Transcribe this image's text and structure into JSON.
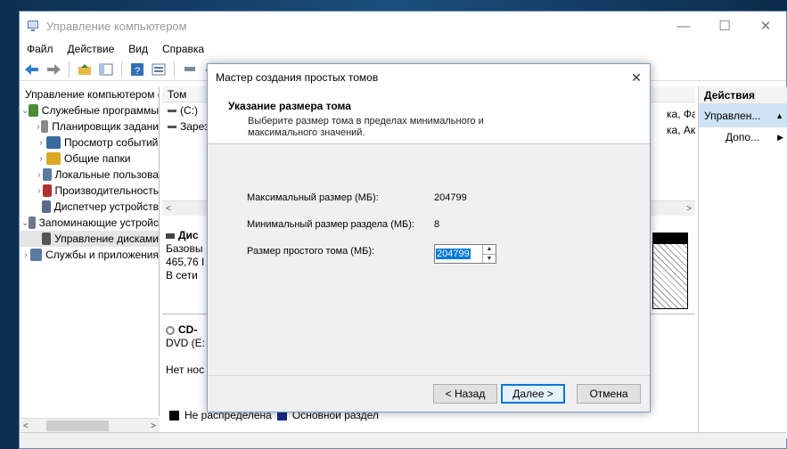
{
  "window": {
    "title": "Управление компьютером",
    "minimize": "—",
    "maximize": "☐",
    "close": "✕"
  },
  "menu": [
    "Файл",
    "Действие",
    "Вид",
    "Справка"
  ],
  "tree": [
    {
      "label": "Управление компьютером (",
      "chev": "",
      "indent": 0,
      "color": "#6a7a8a"
    },
    {
      "label": "Служебные программы",
      "chev": "⌄",
      "indent": 0,
      "color": "#4a8a3a"
    },
    {
      "label": "Планировщик задани",
      "chev": "›",
      "indent": 1,
      "color": "#888"
    },
    {
      "label": "Просмотр событий",
      "chev": "›",
      "indent": 1,
      "color": "#3a6aa0"
    },
    {
      "label": "Общие папки",
      "chev": "›",
      "indent": 1,
      "color": "#d9a825"
    },
    {
      "label": "Локальные пользова",
      "chev": "›",
      "indent": 1,
      "color": "#5a7aa0"
    },
    {
      "label": "Производительность",
      "chev": "›",
      "indent": 1,
      "color": "#b03030"
    },
    {
      "label": "Диспетчер устройств",
      "chev": "",
      "indent": 1,
      "color": "#5a6a8a"
    },
    {
      "label": "Запоминающие устройс",
      "chev": "⌄",
      "indent": 0,
      "color": "#6a7a8a"
    },
    {
      "label": "Управление дисками",
      "chev": "",
      "indent": 1,
      "color": "#555",
      "selected": true
    },
    {
      "label": "Службы и приложения",
      "chev": "›",
      "indent": 0,
      "color": "#5a7aa0"
    }
  ],
  "center": {
    "col_header": "Том",
    "volumes": [
      "(C:)",
      "Зарез"
    ],
    "right_frag1": "ка, Файл",
    "right_frag2": "ка, Акти",
    "disk0": {
      "name": "Дис",
      "l1": "Базовы",
      "l2": "465,76 I",
      "l3": "В сети"
    },
    "cd": {
      "name": "CD-",
      "l1": "DVD (E:",
      "l2": "Нет нос"
    }
  },
  "legend": {
    "unallocated": "Не распределена",
    "primary": "Основной раздел"
  },
  "actions": {
    "header": "Действия",
    "selected": "Управлен...",
    "item": "Допо..."
  },
  "dialog": {
    "title": "Мастер создания простых томов",
    "heading": "Указание размера тома",
    "subheading": "Выберите размер тома в пределах минимального и максимального значений.",
    "fields": [
      {
        "label": "Максимальный размер (МБ):",
        "value": "204799"
      },
      {
        "label": "Минимальный размер раздела (МБ):",
        "value": "8"
      }
    ],
    "size_label": "Размер простого тома (МБ):",
    "size_value": "204799",
    "buttons": {
      "back": "< Назад",
      "next": "Далее >",
      "cancel": "Отмена"
    }
  }
}
